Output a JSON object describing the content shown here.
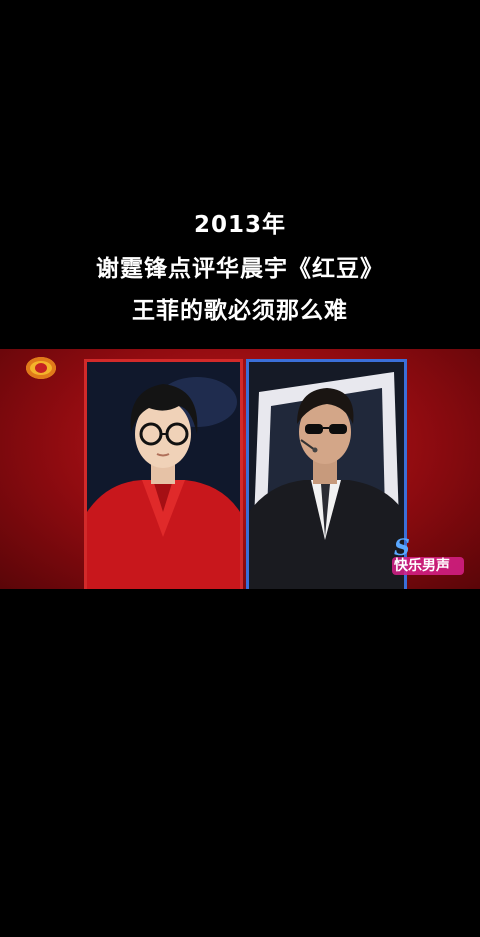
{
  "caption": {
    "line1": "2013年",
    "line2": "谢霆锋点评华晨宇《红豆》",
    "line3": "王菲的歌必须那么难"
  },
  "video": {
    "watermark_text": "快乐男声",
    "background_color": "#b01016",
    "left_frame_color": "#d22a2a",
    "right_frame_color": "#3b6fd8"
  }
}
